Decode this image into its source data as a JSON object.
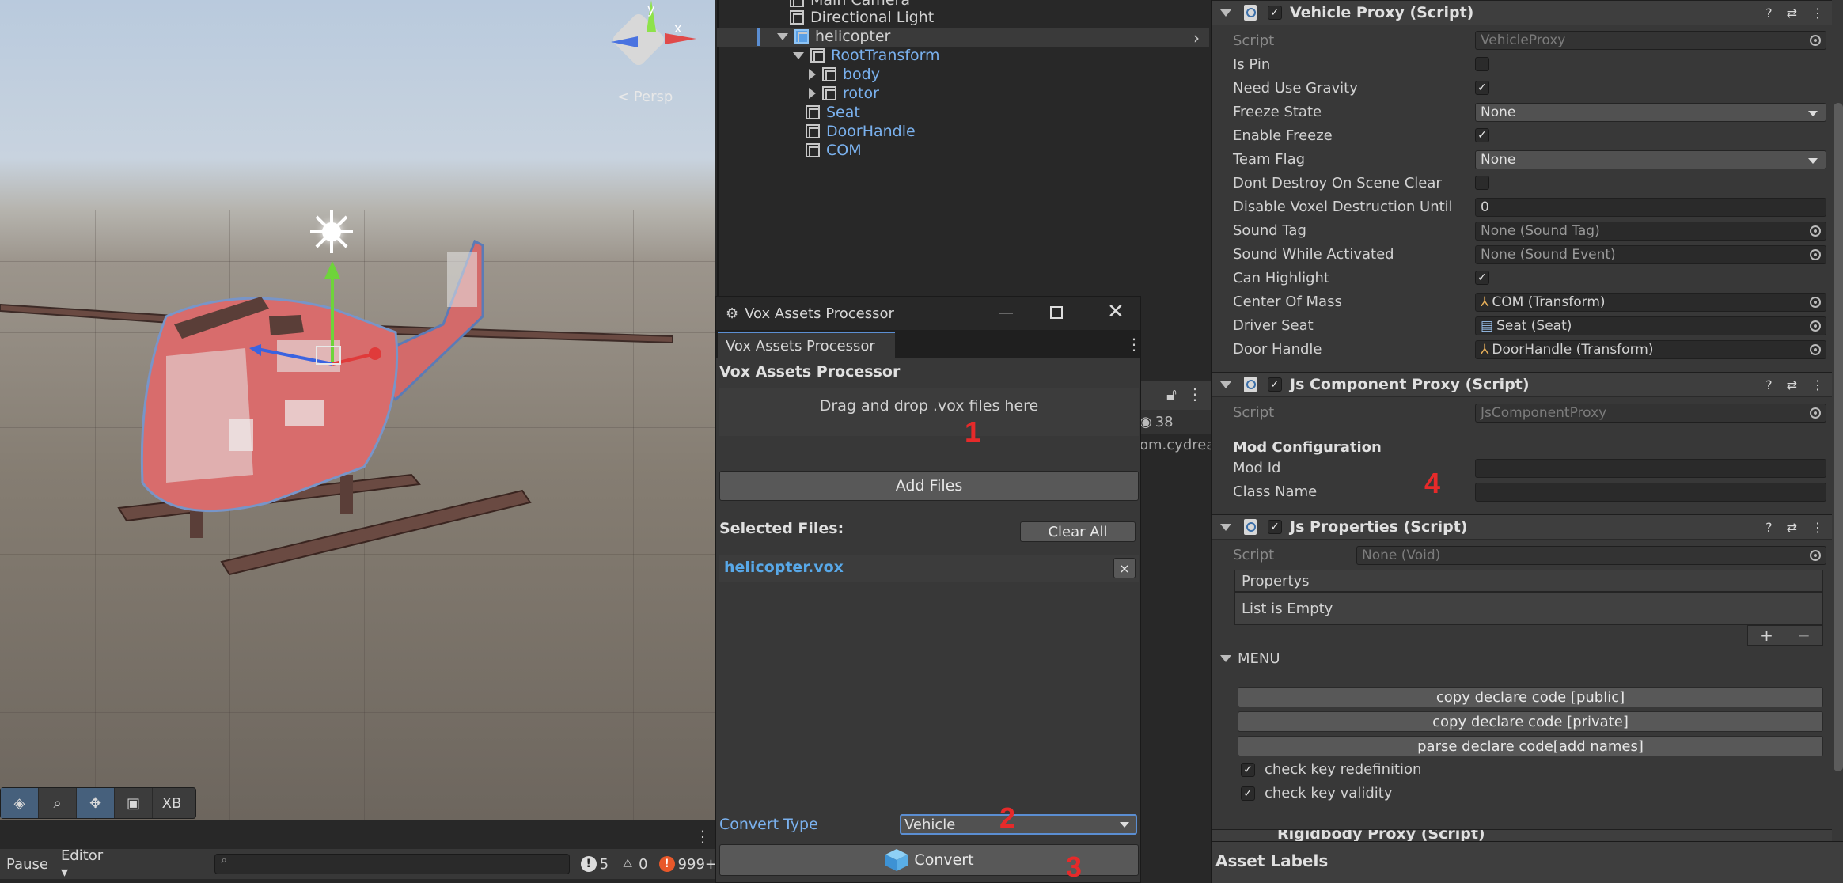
{
  "scene": {
    "toolbar_label": "XB",
    "gizmo": {
      "y": "y",
      "x": "x",
      "persp": "< Persp"
    }
  },
  "console": {
    "pause": "Pause",
    "editor": "Editor",
    "info_count": "5",
    "warning_count": "0",
    "error_count": "999+"
  },
  "hierarchy": {
    "items": [
      {
        "label": "Main Camera"
      },
      {
        "label": "Directional Light"
      },
      {
        "label": "helicopter"
      },
      {
        "label": "RootTransform"
      },
      {
        "label": "body"
      },
      {
        "label": "rotor"
      },
      {
        "label": "Seat"
      },
      {
        "label": "DoorHandle"
      },
      {
        "label": "COM"
      }
    ],
    "project_count": "38",
    "project_path": "om.cydrea"
  },
  "vox": {
    "window_title": "Vox Assets Processor",
    "tab_label": "Vox Assets Processor",
    "heading": "Vox Assets Processor",
    "drop_text": "Drag and drop .vox files here",
    "add_files": "Add Files",
    "selected_files_label": "Selected Files:",
    "clear_all": "Clear All",
    "files": [
      "helicopter.vox"
    ],
    "remove": "×",
    "convert_type_label": "Convert Type",
    "convert_type_value": "Vehicle",
    "convert": "Convert",
    "markers": [
      "1",
      "2",
      "3",
      "4"
    ]
  },
  "inspector": {
    "vehicle_proxy": {
      "title": "Vehicle Proxy (Script)",
      "props": {
        "script": "Script",
        "script_val": "VehicleProxy",
        "is_pin": "Is Pin",
        "need_gravity": "Need Use Gravity",
        "freeze_state": "Freeze State",
        "freeze_state_val": "None",
        "enable_freeze": "Enable Freeze",
        "team_flag": "Team Flag",
        "team_flag_val": "None",
        "dont_destroy": "Dont Destroy On Scene Clear",
        "disable_voxel": "Disable Voxel Destruction Until",
        "disable_voxel_val": "0",
        "sound_tag": "Sound Tag",
        "sound_tag_val": "None (Sound Tag)",
        "sound_active": "Sound While Activated",
        "sound_active_val": "None (Sound Event)",
        "can_highlight": "Can Highlight",
        "center_mass": "Center Of Mass",
        "center_mass_val": "COM (Transform)",
        "driver_seat": "Driver Seat",
        "driver_seat_val": "Seat (Seat)",
        "door_handle": "Door Handle",
        "door_handle_val": "DoorHandle (Transform)"
      }
    },
    "js_component": {
      "title": "Js Component Proxy (Script)",
      "script": "Script",
      "script_val": "JsComponentProxy",
      "mod_config": "Mod Configuration",
      "mod_id": "Mod Id",
      "class_name": "Class Name"
    },
    "js_properties": {
      "title": "Js Properties (Script)",
      "script": "Script",
      "script_val": "None (Void)",
      "list_header": "Propertys",
      "list_empty": "List is Empty",
      "add": "+",
      "remove": "−",
      "menu": "MENU",
      "btn_public": "copy declare code [public]",
      "btn_private": "copy declare code [private]",
      "btn_parse": "parse declare code[add names]",
      "chk_redef": "check key redefinition",
      "chk_validity": "check key validity"
    },
    "rigidbody_partial": "Rigidbody Proxy (Script)",
    "asset_labels": "Asset Labels"
  },
  "colors": {
    "accent": "#5b8ed2",
    "marker": "#e62a2a",
    "link": "#7ab1ee"
  }
}
